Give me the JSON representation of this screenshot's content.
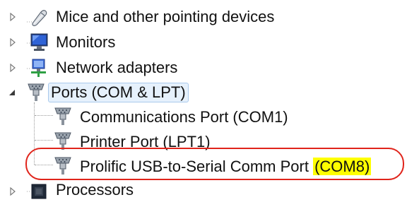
{
  "tree": {
    "items": [
      {
        "label": "Mice and other pointing devices",
        "icon": "mouse-icon",
        "expanded": false
      },
      {
        "label": "Monitors",
        "icon": "monitor-icon",
        "expanded": false
      },
      {
        "label": "Network adapters",
        "icon": "network-adapter-icon",
        "expanded": false
      },
      {
        "label": "Ports (COM & LPT)",
        "icon": "port-icon",
        "expanded": true,
        "selected": true,
        "children": [
          {
            "label": "Communications Port (COM1)",
            "icon": "port-icon"
          },
          {
            "label": "Printer Port (LPT1)",
            "icon": "port-icon"
          },
          {
            "label": "Prolific USB-to-Serial Comm Port",
            "highlight": "(COM8)",
            "icon": "port-icon"
          }
        ]
      },
      {
        "label": "Processors",
        "icon": "processor-icon",
        "expanded": false
      }
    ]
  },
  "colors": {
    "highlight": "#ffff00",
    "annotation_ring": "#e0241b",
    "selection_bg": "#e6f1fc",
    "selection_border": "#a9c9ec"
  }
}
